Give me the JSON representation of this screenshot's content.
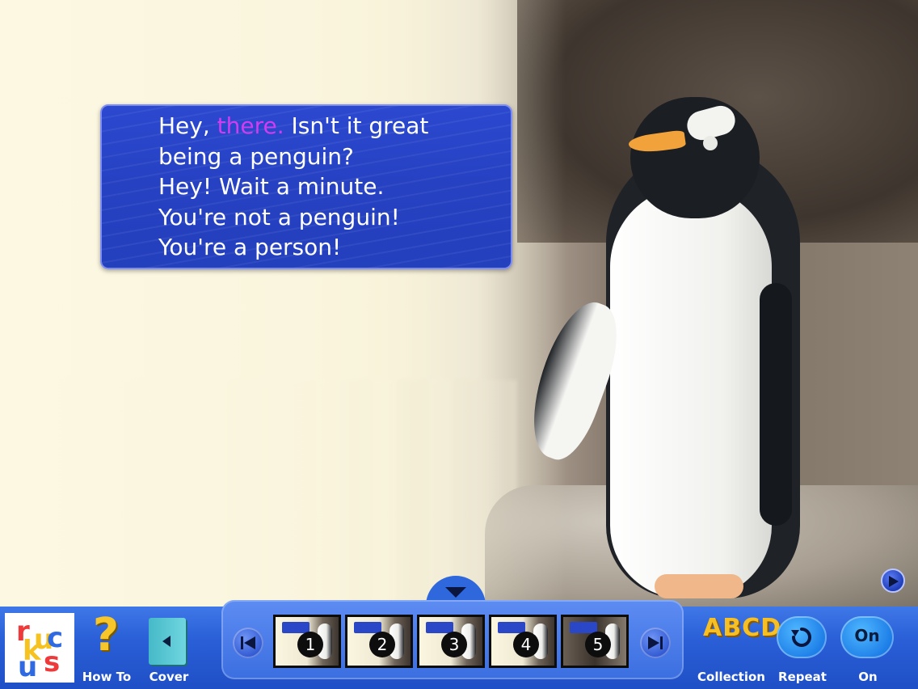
{
  "caption": {
    "lines": [
      {
        "before": "Hey, ",
        "highlight": "there.",
        "after": " Isn't it great"
      },
      "being a penguin?",
      "Hey! Wait a minute.",
      "You're not a penguin!",
      "You're a person!"
    ]
  },
  "colors": {
    "caption_bg": "#2641c2",
    "highlight_word": "#d23cf0",
    "toolbar_bg": "#2a5fd7"
  },
  "toolbar": {
    "logo_letters": [
      "r",
      "u",
      "k",
      "c",
      "u",
      "s"
    ],
    "howto_label": "How To",
    "cover_label": "Cover",
    "collection_label": "Collection",
    "repeat_label": "Repeat",
    "on_label": "On",
    "on_bubble_text": "On",
    "collection_icon_text": "ABCD"
  },
  "pages": {
    "thumbnails": [
      {
        "num": "1"
      },
      {
        "num": "2"
      },
      {
        "num": "3"
      },
      {
        "num": "4"
      },
      {
        "num": "5"
      }
    ],
    "current": 5
  },
  "icons": {
    "first_page": "skip-back-icon",
    "last_page": "skip-forward-icon",
    "next_page": "play-icon",
    "collapse": "triangle-down-icon",
    "repeat": "repeat-icon",
    "cover": "book-icon",
    "howto": "question-mark-icon"
  }
}
